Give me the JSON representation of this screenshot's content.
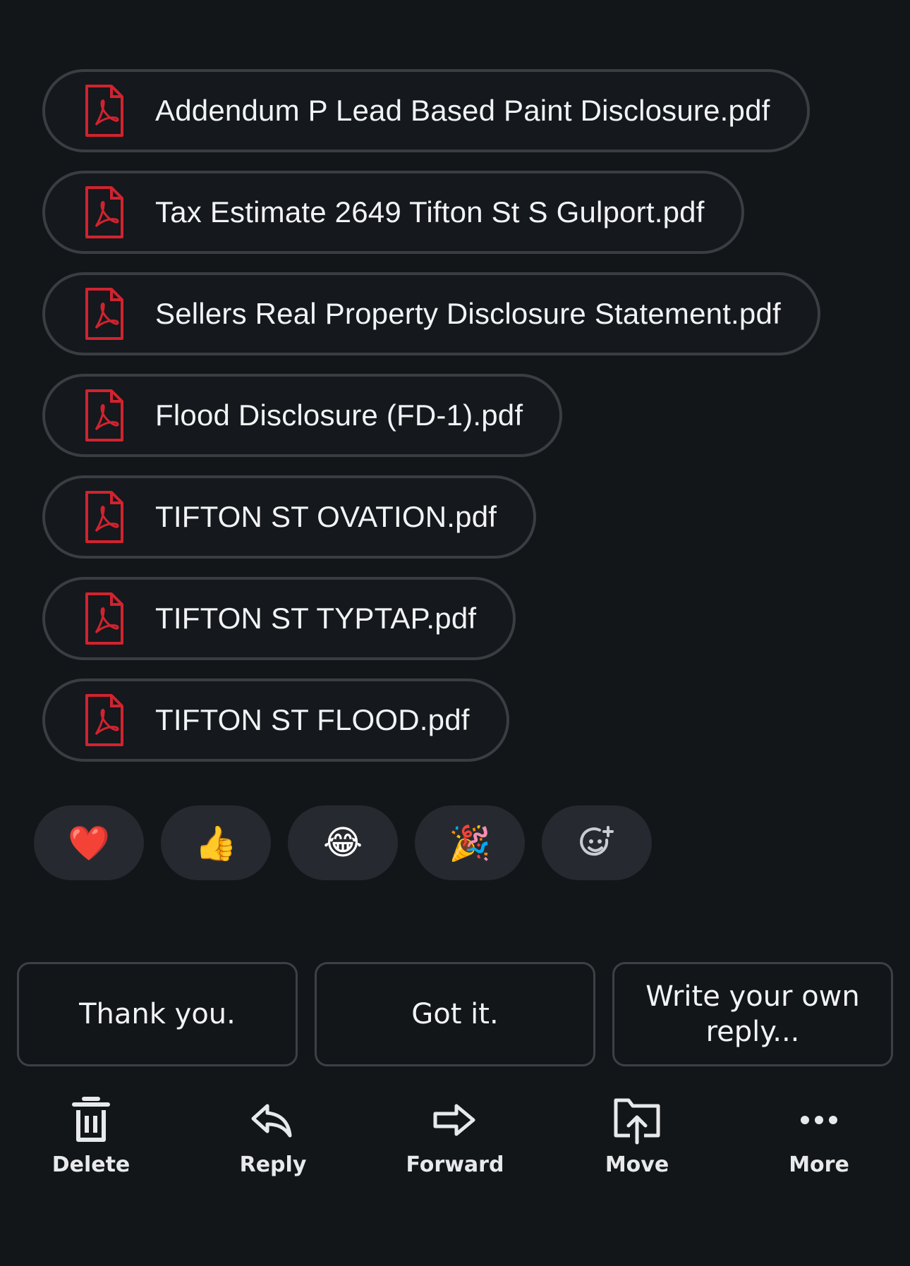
{
  "attachments": [
    {
      "name": "Addendum P Lead Based Paint Disclosure.pdf"
    },
    {
      "name": "Tax Estimate 2649 Tifton St S Gulport.pdf"
    },
    {
      "name": "Sellers Real Property Disclosure Statement.pdf"
    },
    {
      "name": "Flood Disclosure (FD-1).pdf"
    },
    {
      "name": "TIFTON ST OVATION.pdf"
    },
    {
      "name": "TIFTON ST TYPTAP.pdf"
    },
    {
      "name": "TIFTON ST FLOOD.pdf"
    }
  ],
  "reactions": {
    "heart": "❤️",
    "thumbs_up": "👍",
    "laugh": "😂",
    "party": "🎉",
    "add_reaction_icon": "add-emoji-icon"
  },
  "quick_replies": {
    "thank_you": "Thank you.",
    "got_it": "Got it.",
    "write_own": "Write your own reply..."
  },
  "toolbar": {
    "delete": "Delete",
    "reply": "Reply",
    "forward": "Forward",
    "move": "Move",
    "more": "More"
  },
  "colors": {
    "background": "#131619",
    "pill_border": "#3a3e43",
    "reaction_bg": "#262a30",
    "pdf_red": "#d1232f"
  }
}
